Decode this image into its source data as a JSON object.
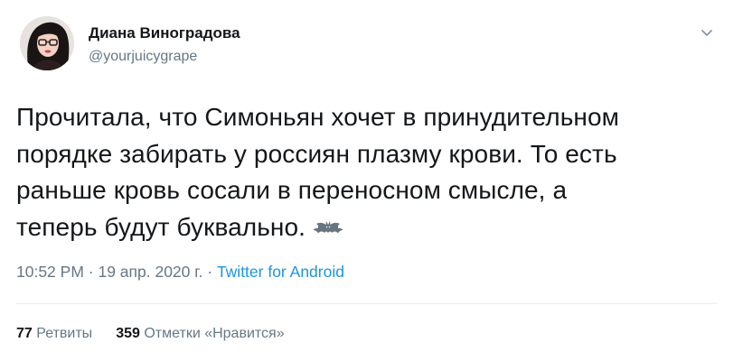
{
  "author": {
    "name": "Диана Виноградова",
    "handle": "@yourjuicygrape"
  },
  "tweet": {
    "lines": [
      "Прочитала, что Симоньян хочет в принудительном",
      "порядке забирать у россиян плазму крови. То есть",
      "раньше кровь сосали в переносном смысле, а",
      "теперь будут буквально."
    ],
    "emoji": "bat-emoji"
  },
  "meta": {
    "time": "10:52 PM",
    "sep1": " · ",
    "date": "19 апр. 2020 г.",
    "sep2": " · ",
    "source": "Twitter for Android"
  },
  "stats": {
    "retweets_count": "77",
    "retweets_label": "Ретвиты",
    "likes_count": "359",
    "likes_label": "Отметки «Нравится»"
  },
  "colors": {
    "text": "#14171a",
    "secondary": "#657786",
    "link": "#1b95e0",
    "divider": "#e6ecf0"
  },
  "icons": {
    "menu": "chevron-down-icon",
    "avatar": "profile-photo"
  }
}
